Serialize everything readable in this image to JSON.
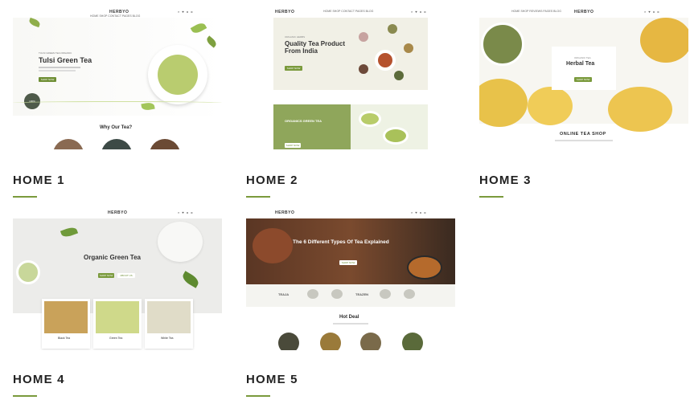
{
  "demos": [
    {
      "label": "HOME 1",
      "brand": "HERBYO",
      "menu": "HOME  SHOP  CONTACT  PAGES  BLOG",
      "subtitle": "TULSI GREEN TEA ORGANIC",
      "title": "Tulsi Green Tea",
      "button": "SHOP NOW",
      "section": "Why Our Tea?",
      "badge": "100% NATURAL"
    },
    {
      "label": "HOME 2",
      "brand": "HERBYO",
      "menu": "HOME  SHOP  CONTACT  PAGES  BLOG",
      "subtitle": "ORGANIC HERBS",
      "title": "Quality Tea Product From India",
      "button": "SHOP NOW",
      "banner": "ORGANICS GREEN TEA",
      "banner_button": "SHOP NOW"
    },
    {
      "label": "HOME 3",
      "brand": "HERBYO",
      "menu": "HOME  SHOP  REVIEWS  PAGES  BLOG",
      "subtitle": "ORGANIC TEA",
      "title": "Herbal Tea",
      "button": "SHOP NOW",
      "section": "ONLINE TEA SHOP"
    },
    {
      "label": "HOME 4",
      "brand": "HERBYO",
      "title": "Organic Green Tea",
      "button": "SHOP NOW",
      "button2": "ABOUT US",
      "products": [
        "Black Tea",
        "Green Tea",
        "White Tea"
      ]
    },
    {
      "label": "HOME 5",
      "brand": "HERBYO",
      "title": "The 6 Different Types Of Tea Explained",
      "button": "SHOP NOW",
      "logos": [
        "TEAJA",
        "TEAZEN"
      ],
      "section": "Hot Deal"
    }
  ]
}
